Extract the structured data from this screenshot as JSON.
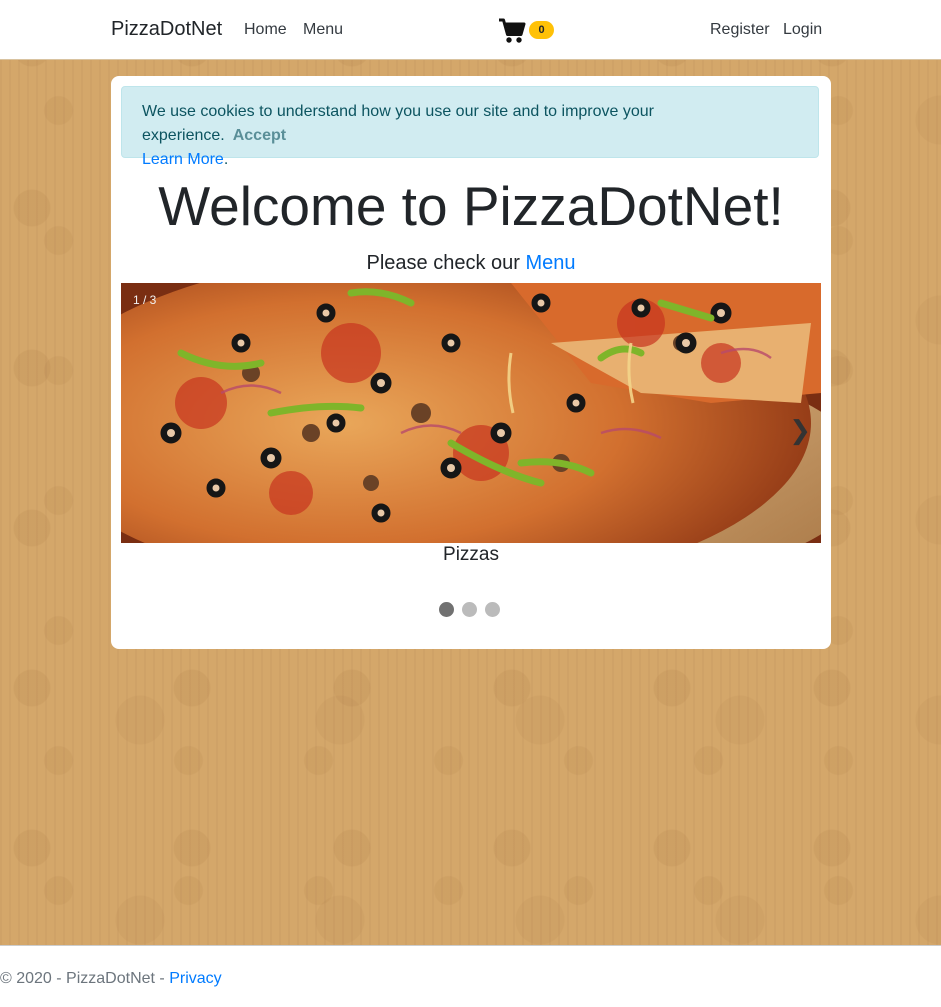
{
  "nav": {
    "brand": "PizzaDotNet",
    "home": "Home",
    "menu": "Menu",
    "cart_icon": "shopping-cart-icon",
    "cart_count": "0",
    "register": "Register",
    "login": "Login"
  },
  "cookie": {
    "message": "We use cookies to understand how you use our site and to improve your experience.",
    "accept": "Accept",
    "learn_more": "Learn More",
    "period": "."
  },
  "hero": {
    "title": "Welcome to PizzaDotNet!",
    "subtitle_prefix": "Please check our ",
    "subtitle_link": "Menu"
  },
  "slideshow": {
    "counter": "1 / 3",
    "next_icon": "chevron-right-icon",
    "next_glyph": "❯",
    "caption": "Pizzas",
    "active_slide": 1,
    "total_slides": 3
  },
  "footer": {
    "copyright": "© 2020 - PizzaDotNet - ",
    "privacy": "Privacy"
  },
  "colors": {
    "badge": "#ffc107",
    "link": "#007bff",
    "cookie_bg": "#d1ecf1",
    "page_bg": "#d4a76a",
    "dot_active": "#717171",
    "dot_inactive": "#bbbbbb"
  }
}
